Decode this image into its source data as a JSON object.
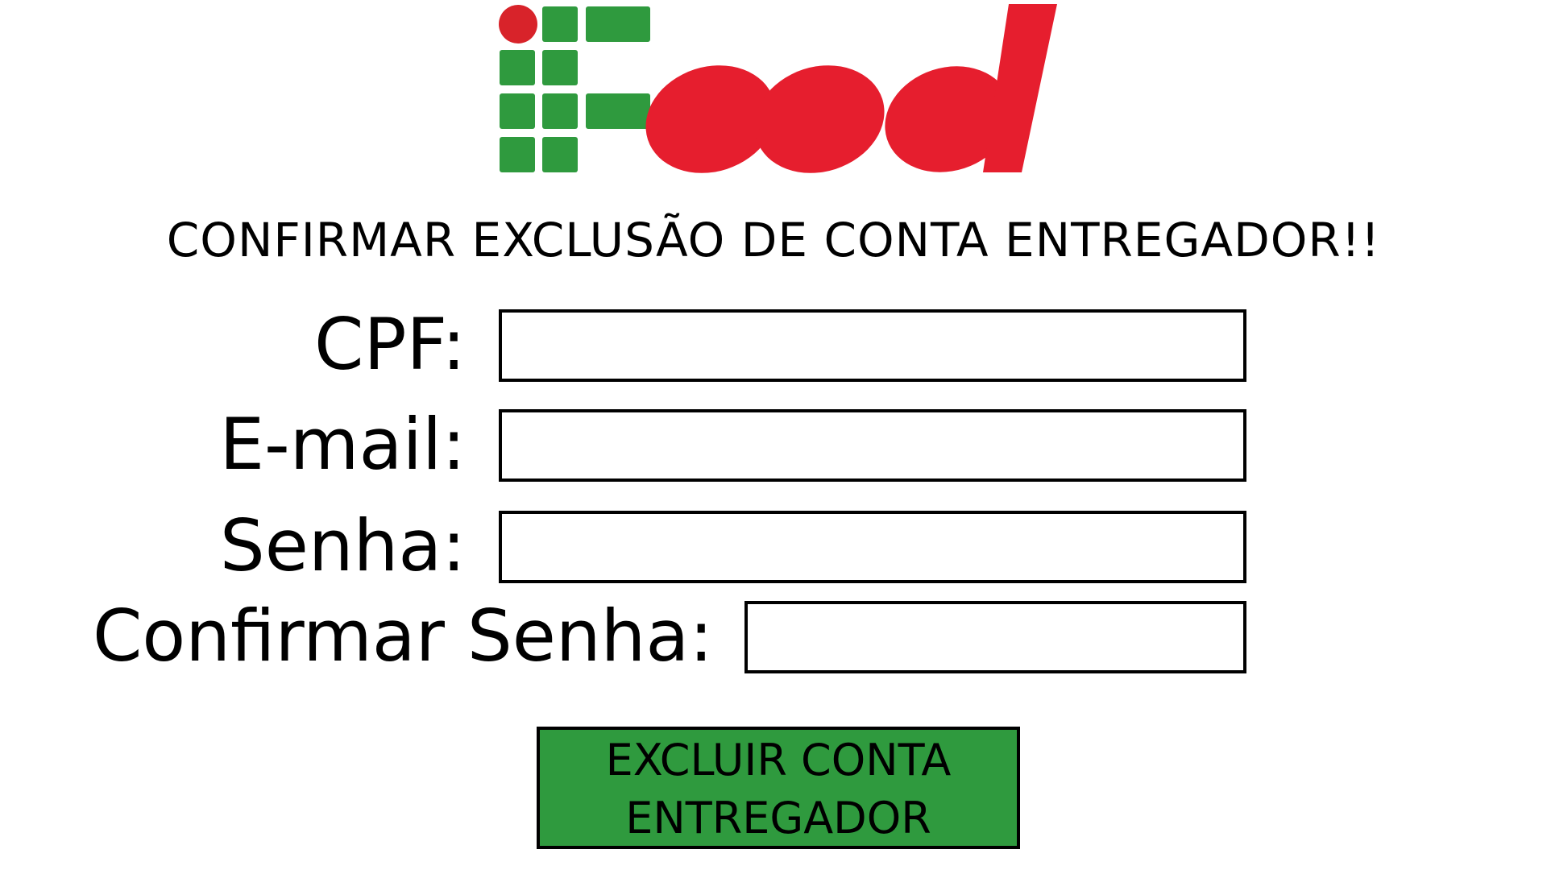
{
  "brand": {
    "logo_text": "iFood",
    "logo_icon": "iffood-logo-icon",
    "grid_color": "#2f9a3e",
    "dot_color": "#d8232a",
    "wordmark_color": "#e61e2e"
  },
  "page": {
    "title": "CONFIRMAR EXCLUSÃO DE CONTA ENTREGADOR!!"
  },
  "form": {
    "cpf": {
      "label": "CPF:",
      "value": ""
    },
    "email": {
      "label": "E-mail:",
      "value": ""
    },
    "password": {
      "label": "Senha:",
      "value": ""
    },
    "confirm_password": {
      "label": "Confirmar Senha:",
      "value": ""
    }
  },
  "actions": {
    "delete_line1": "EXCLUIR CONTA",
    "delete_line2": "ENTREGADOR",
    "delete_color": "#2f9a3e"
  }
}
